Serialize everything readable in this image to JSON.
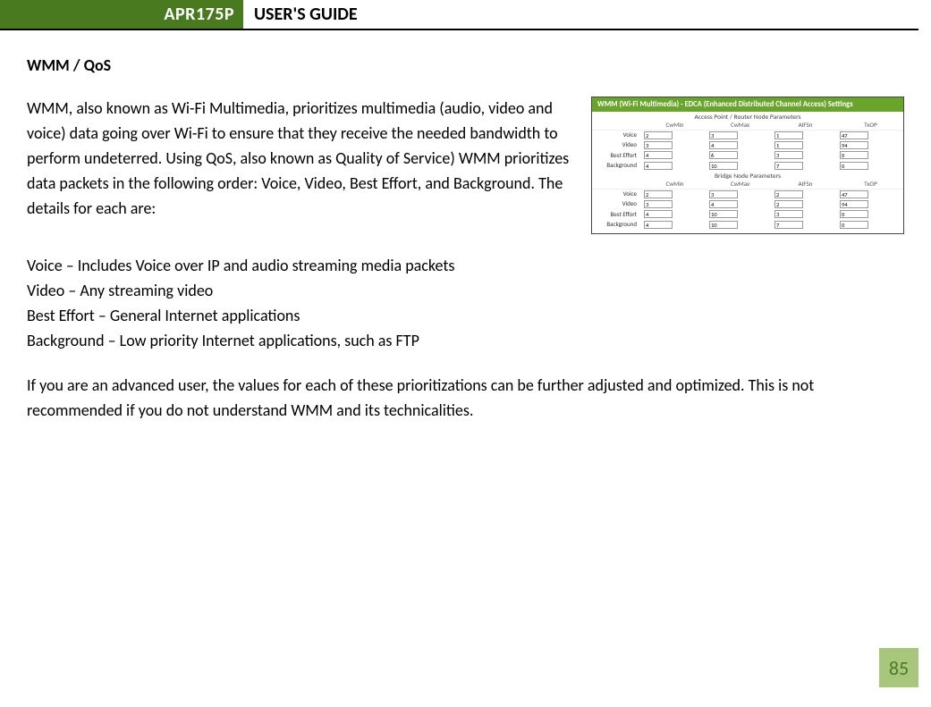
{
  "header": {
    "model": "APR175P",
    "title": "USER'S GUIDE"
  },
  "section": {
    "heading": "WMM / QoS",
    "intro": "WMM, also known as Wi-Fi Multimedia, prioritizes multimedia (audio, video and voice) data going over Wi-Fi to ensure that they receive the needed bandwidth to perform undeterred. Using QoS, also known as Quality of Service) WMM prioritizes data packets in the following order: Voice, Video, Best Effort, and Background. The details for each are:",
    "defs": {
      "voice": "Voice – Includes Voice over IP and audio streaming media packets",
      "video": "Video – Any streaming video",
      "best_effort": "Best Effort – General Internet applications",
      "background": "Background – Low priority Internet applications, such as FTP"
    },
    "closing": "If you are an advanced user, the values for each of these prioritizations can be further adjusted and optimized. This is not recommended if you do not understand WMM and its technicalities."
  },
  "panel": {
    "banner": "WMM (Wi-Fi Multimedia) - EDCA (Enhanced Distributed Channel Access) Settings",
    "group1_title": "Access Point / Router Node Parameters",
    "group2_title": "Bridge Node Parameters",
    "cols": [
      "CwMin",
      "CwMax",
      "AIFSn",
      "TxOP"
    ],
    "rows1": [
      {
        "label": "Voice",
        "v": [
          "2",
          "3",
          "1",
          "47"
        ]
      },
      {
        "label": "Video",
        "v": [
          "3",
          "4",
          "1",
          "94"
        ]
      },
      {
        "label": "Best Effort",
        "v": [
          "4",
          "6",
          "3",
          "0"
        ]
      },
      {
        "label": "Background",
        "v": [
          "4",
          "10",
          "7",
          "0"
        ]
      }
    ],
    "rows2": [
      {
        "label": "Voice",
        "v": [
          "2",
          "3",
          "2",
          "47"
        ]
      },
      {
        "label": "Video",
        "v": [
          "3",
          "4",
          "2",
          "94"
        ]
      },
      {
        "label": "Best Effort",
        "v": [
          "4",
          "10",
          "3",
          "0"
        ]
      },
      {
        "label": "Background",
        "v": [
          "4",
          "10",
          "7",
          "0"
        ]
      }
    ]
  },
  "page_number": "85"
}
